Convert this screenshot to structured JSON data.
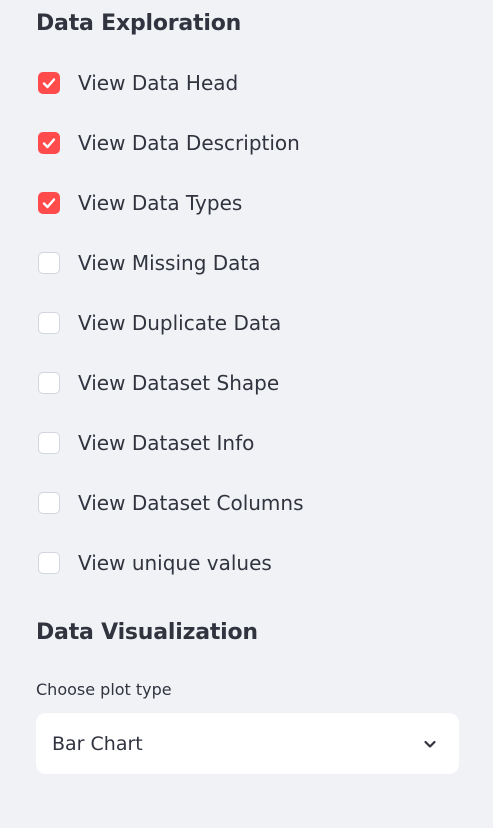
{
  "sidebar": {
    "exploration_title": "Data Exploration",
    "options": [
      {
        "label": "View Data Head",
        "checked": true
      },
      {
        "label": "View Data Description",
        "checked": true
      },
      {
        "label": "View Data Types",
        "checked": true
      },
      {
        "label": "View Missing Data",
        "checked": false
      },
      {
        "label": "View Duplicate Data",
        "checked": false
      },
      {
        "label": "View Dataset Shape",
        "checked": false
      },
      {
        "label": "View Dataset Info",
        "checked": false
      },
      {
        "label": "View Dataset Columns",
        "checked": false
      },
      {
        "label": "View unique values",
        "checked": false
      }
    ],
    "visualization_title": "Data Visualization",
    "plot_select": {
      "label": "Choose plot type",
      "value": "Bar Chart",
      "icon": "chevron-down-icon"
    }
  },
  "colors": {
    "background": "#f0f2f6",
    "accent": "#ff4b4b",
    "text": "#31333f",
    "input_background": "#ffffff"
  }
}
